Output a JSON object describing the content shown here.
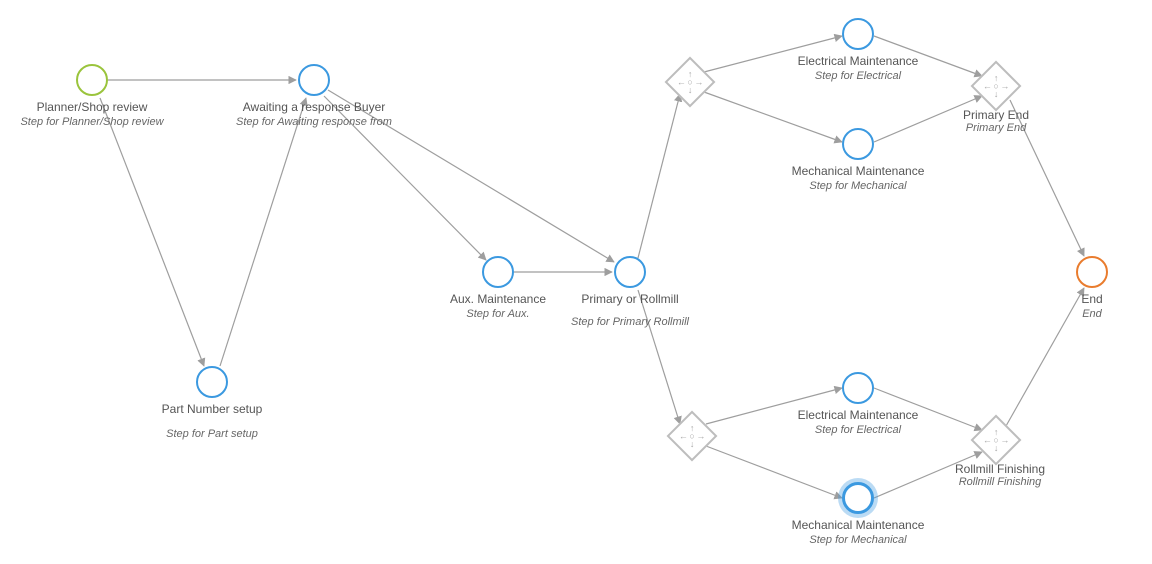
{
  "nodes": {
    "planner": {
      "title": "Planner/Shop review",
      "subtitle": "Step for Planner/Shop review"
    },
    "awaiting": {
      "title": "Awaiting a response Buyer",
      "subtitle": "Step for Awaiting response from"
    },
    "partnum": {
      "title": "Part Number setup",
      "subtitle": "Step for Part setup"
    },
    "aux": {
      "title": "Aux. Maintenance",
      "subtitle": "Step for Aux."
    },
    "primary": {
      "title": "Primary or Rollmill",
      "subtitle": "Step for Primary Rollmill"
    },
    "elecTop": {
      "title": "Electrical Maintenance",
      "subtitle": "Step for Electrical"
    },
    "mechTop": {
      "title": "Mechanical Maintenance",
      "subtitle": "Step for Mechanical"
    },
    "elecBot": {
      "title": "Electrical Maintenance",
      "subtitle": "Step for Electrical"
    },
    "mechBot": {
      "title": "Mechanical Maintenance",
      "subtitle": "Step for Mechanical"
    },
    "end": {
      "title": "End",
      "subtitle": "End"
    }
  },
  "gateways": {
    "gw1": {
      "label_title": "",
      "label_sub": ""
    },
    "gwPrimary": {
      "label_title": "Primary End",
      "label_sub": "Primary End"
    },
    "gw2": {
      "label_title": "",
      "label_sub": ""
    },
    "gwRollmill": {
      "label_title": "Rollmill Finishing",
      "label_sub": "Rollmill Finishing"
    }
  }
}
